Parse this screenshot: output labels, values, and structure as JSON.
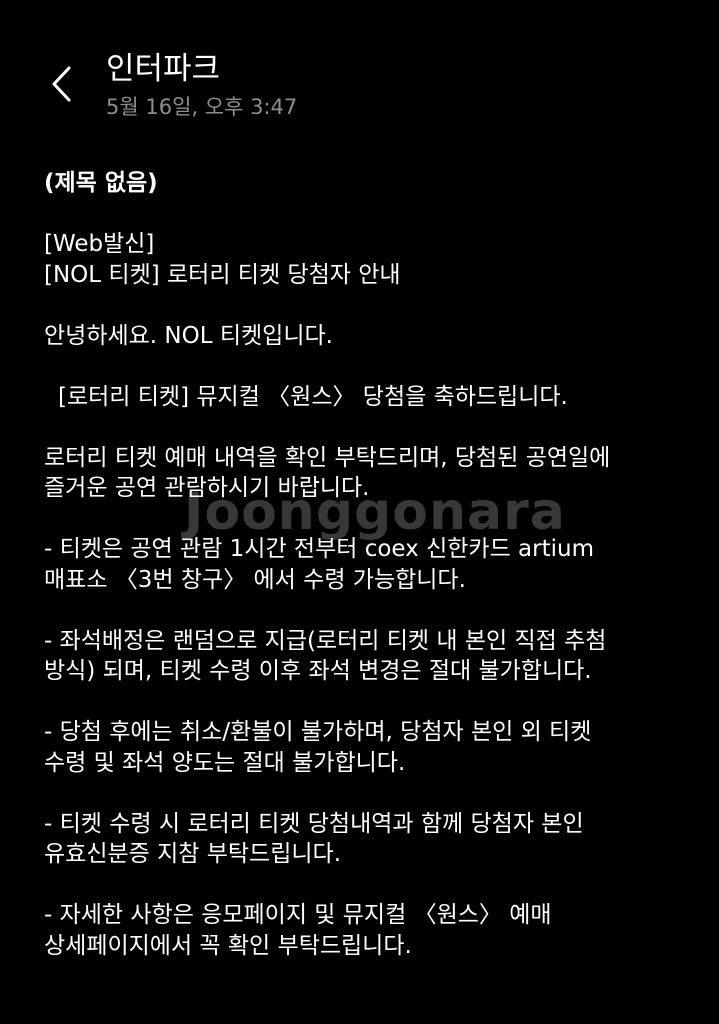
{
  "header": {
    "sender": "인터파크",
    "timestamp": "5월 16일, 오후 3:47",
    "back_icon": "chevron-left-icon"
  },
  "message": {
    "subject": "(제목 없음)",
    "lines": [
      "[Web발신]",
      "[NOL 티켓] 로터리 티켓 당첨자 안내",
      "",
      "안녕하세요. NOL 티켓입니다.",
      "",
      "[로터리 티켓]   뮤지컬 〈원스〉 당첨을 축하드립니다.",
      "",
      "로터리 티켓 예매 내역을 확인 부탁드리며, 당첨된 공연일에",
      "즐거운 공연 관람하시기 바랍니다.",
      "",
      "- 티켓은 공연 관람 1시간 전부터 coex 신한카드 artium",
      "매표소 〈3번 창구〉 에서 수령 가능합니다.",
      "",
      "- 좌석배정은 랜덤으로 지급(로터리 티켓 내 본인 직접 추첨",
      "방식) 되며, 티켓 수령 이후 좌석 변경은 절대 불가합니다.",
      "",
      "- 당첨 후에는 취소/환불이 불가하며, 당첨자 본인 외 티켓",
      "수령 및 좌석 양도는 절대 불가합니다.",
      "",
      "- 티켓 수령 시 로터리 티켓 당첨내역과 함께 당첨자 본인",
      "유효신분증 지참 부탁드립니다.",
      "",
      "- 자세한 사항은 응모페이지 및 뮤지컬 〈원스〉 예매",
      "상세페이지에서 꼭 확인 부탁드립니다."
    ]
  },
  "watermark": "Joonggonara",
  "colors": {
    "background": "#000000",
    "text": "#ffffff",
    "timestamp": "#8e8e8e"
  }
}
